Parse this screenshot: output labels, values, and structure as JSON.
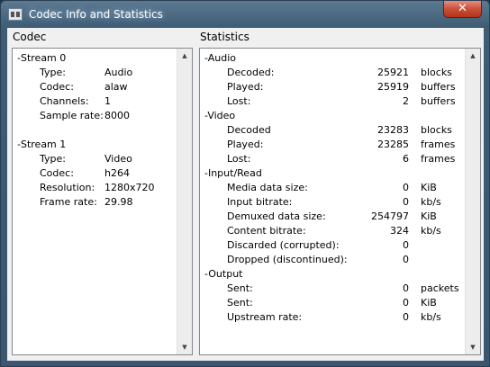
{
  "window": {
    "title": "Codec Info and Statistics",
    "close": "✕"
  },
  "codec_pane": {
    "header": "Codec",
    "streams": [
      {
        "label": "-Stream 0",
        "props": [
          {
            "key": "Type:",
            "value": "Audio"
          },
          {
            "key": "Codec:",
            "value": "alaw"
          },
          {
            "key": "Channels:",
            "value": "1"
          },
          {
            "key": "Sample rate:",
            "value": "8000"
          }
        ]
      },
      {
        "label": "-Stream 1",
        "props": [
          {
            "key": "Type:",
            "value": "Video"
          },
          {
            "key": "Codec:",
            "value": "h264"
          },
          {
            "key": "Resolution:",
            "value": "1280x720"
          },
          {
            "key": "Frame rate:",
            "value": "29.98"
          }
        ]
      }
    ]
  },
  "stats_pane": {
    "header": "Statistics",
    "groups": [
      {
        "label": "-Audio",
        "rows": [
          {
            "key": "Decoded:",
            "value": "25921",
            "unit": "blocks"
          },
          {
            "key": "Played:",
            "value": "25919",
            "unit": "buffers"
          },
          {
            "key": "Lost:",
            "value": "2",
            "unit": "buffers"
          }
        ]
      },
      {
        "label": "-Video",
        "rows": [
          {
            "key": "Decoded",
            "value": "23283",
            "unit": "blocks"
          },
          {
            "key": "Played:",
            "value": "23285",
            "unit": "frames"
          },
          {
            "key": "Lost:",
            "value": "6",
            "unit": "frames"
          }
        ]
      },
      {
        "label": "-Input/Read",
        "rows": [
          {
            "key": "Media data size:",
            "value": "0",
            "unit": "KiB"
          },
          {
            "key": "Input bitrate:",
            "value": "0",
            "unit": "kb/s"
          },
          {
            "key": "Demuxed data size:",
            "value": "254797",
            "unit": "KiB"
          },
          {
            "key": "Content bitrate:",
            "value": "324",
            "unit": "kb/s"
          },
          {
            "key": "Discarded (corrupted):",
            "value": "0",
            "unit": ""
          },
          {
            "key": "Dropped (discontinued):",
            "value": "0",
            "unit": ""
          }
        ]
      },
      {
        "label": "-Output",
        "rows": [
          {
            "key": "Sent:",
            "value": "0",
            "unit": "packets"
          },
          {
            "key": "Sent:",
            "value": "0",
            "unit": "KiB"
          },
          {
            "key": "Upstream rate:",
            "value": "0",
            "unit": "kb/s"
          }
        ]
      }
    ]
  }
}
